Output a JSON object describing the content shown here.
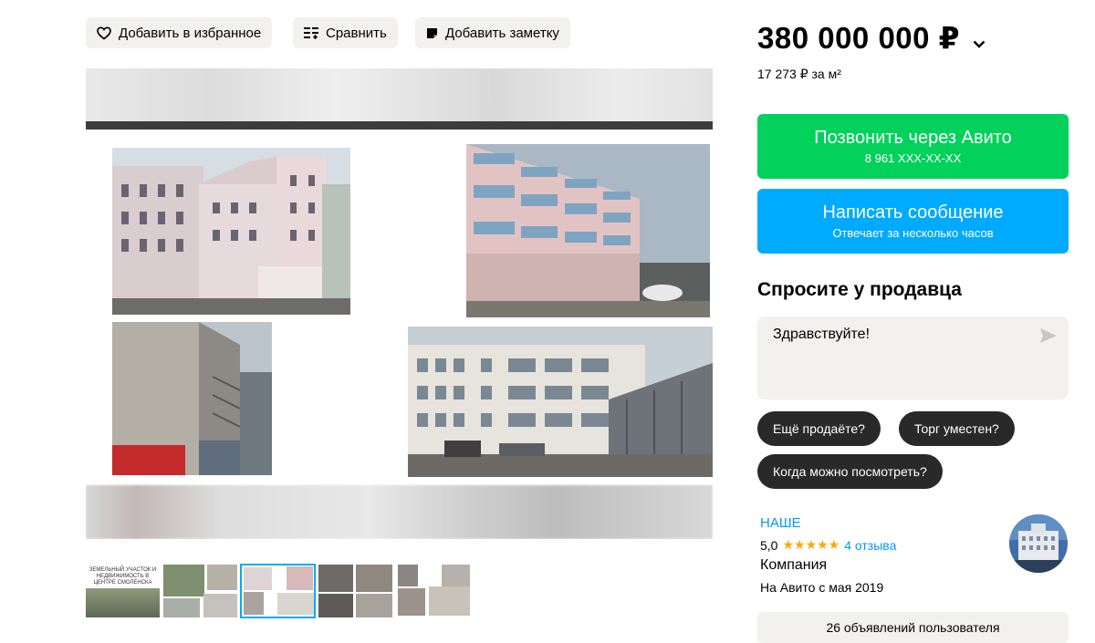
{
  "actions": {
    "favorite_label": "Добавить в избранное",
    "compare_label": "Сравнить",
    "note_label": "Добавить заметку"
  },
  "thumbnails": {
    "first_caption": "ЗЕМЕЛЬНЫЙ УЧАСТОК И НЕДВИЖИМОСТЬ В ЦЕНТРЕ СМОЛЕНСКА",
    "active_index": 2
  },
  "price": {
    "main": "380 000 000 ₽",
    "per_m2": "17 273 ₽ за м²"
  },
  "call_button": {
    "label": "Позвонить через Авито",
    "phone": "8 961 XXX-XX-XX",
    "color": "#02d15c"
  },
  "message_button": {
    "label": "Написать сообщение",
    "sub": "Отвечает за несколько часов",
    "color": "#00aaff"
  },
  "ask": {
    "title": "Спросите у продавца",
    "message_value": "Здравствуйте!",
    "chips": [
      "Ещё продаёте?",
      "Торг уместен?",
      "Когда можно посмотреть?"
    ]
  },
  "seller": {
    "name": "НАШЕ",
    "rating": "5,0",
    "stars": "★★★★★",
    "reviews": "4 отзыва",
    "type": "Компания",
    "since": "На Авито с мая 2019",
    "listings": "26 объявлений пользователя"
  }
}
